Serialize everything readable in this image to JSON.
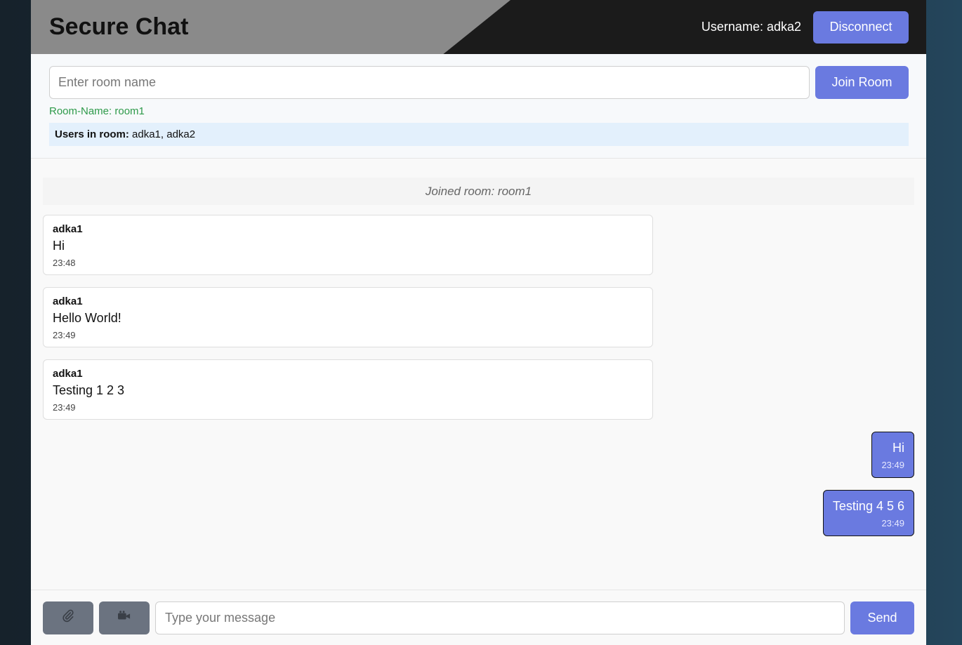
{
  "header": {
    "title": "Secure Chat",
    "username_label": "Username: adka2",
    "disconnect_label": "Disconnect"
  },
  "room": {
    "input_placeholder": "Enter room name",
    "join_label": "Join Room",
    "room_name_text": "Room-Name: room1",
    "users_label": "Users in room:",
    "users_value": " adka1, adka2"
  },
  "messages": {
    "system": "Joined room: room1",
    "incoming": [
      {
        "sender": "adka1",
        "text": "Hi",
        "time": "23:48"
      },
      {
        "sender": "adka1",
        "text": "Hello World!",
        "time": "23:49"
      },
      {
        "sender": "adka1",
        "text": "Testing 1 2 3",
        "time": "23:49"
      }
    ],
    "outgoing": [
      {
        "text": "Hi",
        "time": "23:49"
      },
      {
        "text": "Testing 4 5 6",
        "time": "23:49"
      }
    ]
  },
  "composer": {
    "attach_icon": "paperclip-icon",
    "video_icon": "video-camera-icon",
    "message_placeholder": "Type your message",
    "send_label": "Send"
  },
  "colors": {
    "accent": "#6a7ae0",
    "room_name_green": "#2e9a4a",
    "users_bg": "#e3f0fc",
    "icon_button_gray": "#6b7380"
  }
}
